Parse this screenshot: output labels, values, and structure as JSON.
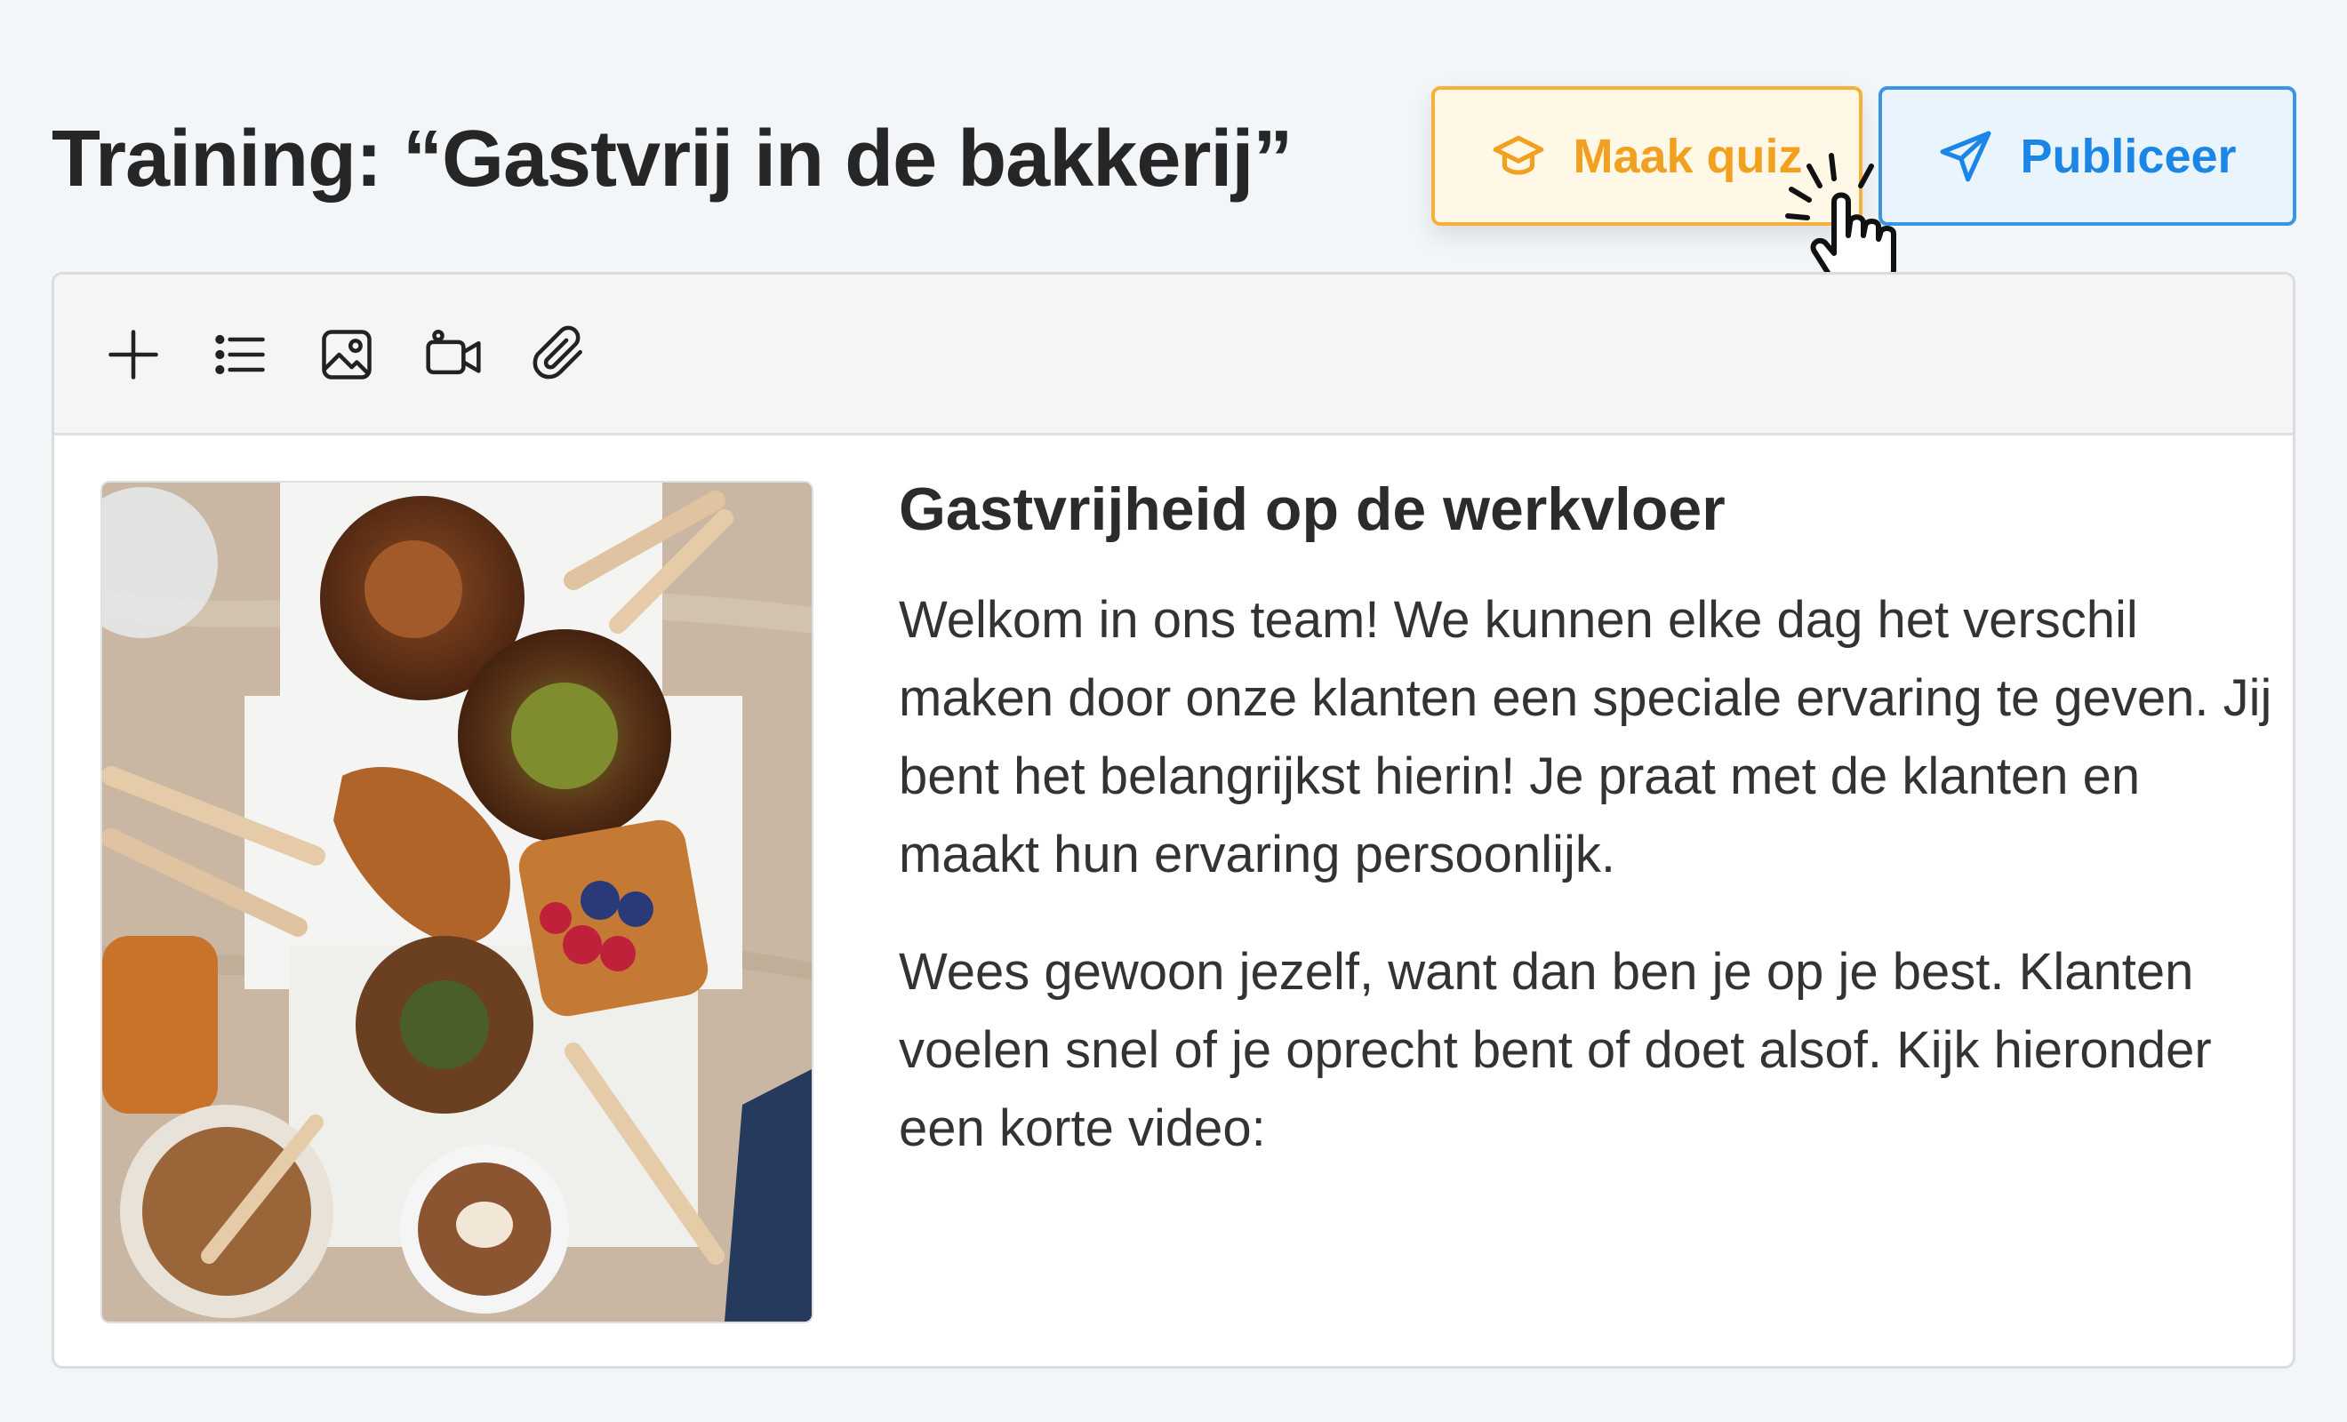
{
  "page": {
    "title": "Training: “Gastvrij in de bakkerij”"
  },
  "actions": {
    "quiz_label": "Maak quiz",
    "publish_label": "Publiceer"
  },
  "toolbar": {
    "tools": [
      "plus-icon",
      "list-icon",
      "image-icon",
      "video-icon",
      "attachment-icon"
    ]
  },
  "content": {
    "heading": "Gastvrijheid op de werkvloer",
    "paragraph1": "Welkom in ons team! We kunnen elke dag het verschil maken door onze klanten een speciale ervaring te geven. Jij bent het belangrijkst hierin! Je praat met de klanten en maakt hun ervaring persoonlijk.",
    "paragraph2": "Wees gewoon jezelf, want dan ben je op je best. Klanten voelen snel of je oprecht bent of doet alsof. Kijk hieronder een korte video:"
  },
  "colors": {
    "quiz_accent": "#f2a01f",
    "publish_accent": "#1b86e6"
  }
}
